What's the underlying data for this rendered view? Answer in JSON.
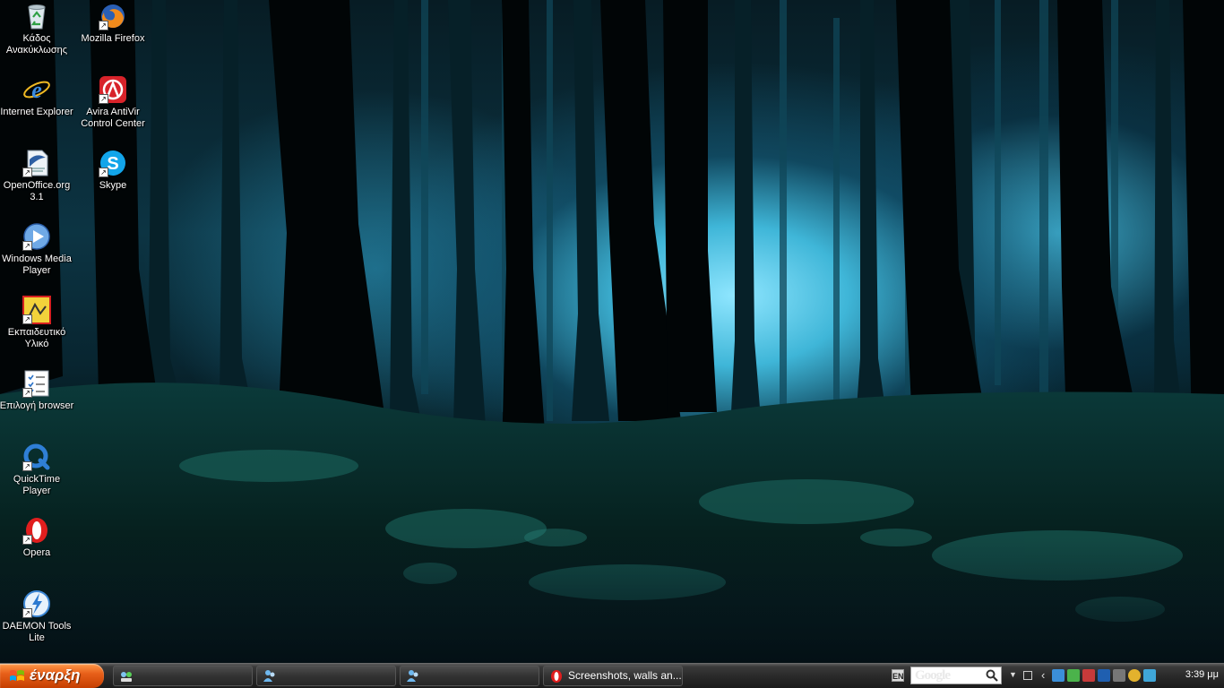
{
  "desktop": {
    "icons": [
      {
        "label": "Κάδος Ανακύκλωσης",
        "icon": "recycle-bin-icon"
      },
      {
        "label": "Mozilla Firefox",
        "icon": "firefox-icon"
      },
      {
        "label": "Internet Explorer",
        "icon": "internet-explorer-icon"
      },
      {
        "label": "Avira AntiVir Control Center",
        "icon": "avira-icon"
      },
      {
        "label": "OpenOffice.org 3.1",
        "icon": "openoffice-icon"
      },
      {
        "label": "Skype",
        "icon": "skype-icon"
      },
      {
        "label": "Windows Media Player",
        "icon": "media-player-icon"
      },
      {
        "label": "Εκπαιδευτικό Υλικό",
        "icon": "educational-material-icon"
      },
      {
        "label": "Επιλογή browser",
        "icon": "browser-choice-icon"
      },
      {
        "label": "QuickTime Player",
        "icon": "quicktime-icon"
      },
      {
        "label": "Opera",
        "icon": "opera-icon"
      },
      {
        "label": "DAEMON Tools Lite",
        "icon": "daemon-tools-icon"
      }
    ]
  },
  "taskbar": {
    "start_label": "έναρξη",
    "tasks": [
      {
        "label": "",
        "icon": "network-icon"
      },
      {
        "label": "",
        "icon": "messenger-icon"
      },
      {
        "label": "",
        "icon": "messenger-icon"
      },
      {
        "label": "Screenshots, walls an...",
        "icon": "opera-icon"
      }
    ],
    "language": "EN",
    "search_placeholder": "Google",
    "clock": "3:39 μμ"
  }
}
